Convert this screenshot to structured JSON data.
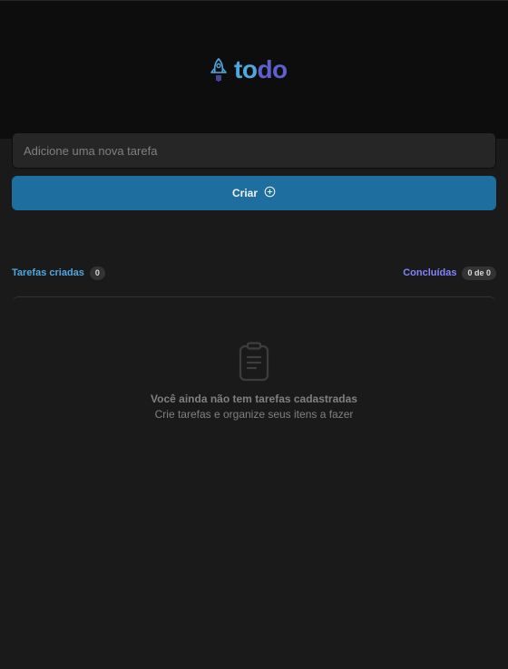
{
  "header": {
    "logo_icon": "rocket-icon",
    "logo_part1": "to",
    "logo_part2": "do",
    "colors": {
      "blue": "#4ea8de",
      "purple": "#5e60ce"
    }
  },
  "form": {
    "input_placeholder": "Adicione uma nova tarefa",
    "input_value": "",
    "create_label": "Criar",
    "create_icon": "plus-circle-icon"
  },
  "counters": {
    "created_label": "Tarefas criadas",
    "created_count": "0",
    "done_label": "Concluídas",
    "done_count": "0 de 0"
  },
  "empty_state": {
    "icon": "clipboard-icon",
    "title": "Você ainda não tem tarefas cadastradas",
    "subtitle": "Crie tarefas e organize seus itens a fazer"
  }
}
